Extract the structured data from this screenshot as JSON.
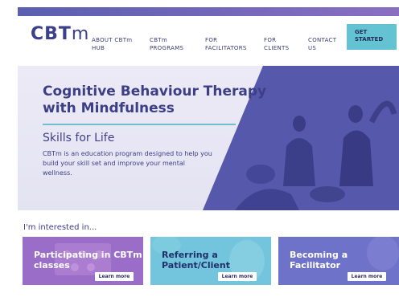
{
  "brand": {
    "logo": "CBTm",
    "logo_main": "CBT",
    "logo_m": "m"
  },
  "nav": {
    "items": [
      {
        "line1": "ABOUT CBTm",
        "line2": "HUB"
      },
      {
        "line1": "CBTm",
        "line2": "PROGRAMS"
      },
      {
        "line1": "FOR",
        "line2": "FACILITATORS"
      },
      {
        "line1": "FOR",
        "line2": "CLIENTS"
      },
      {
        "line1": "CONTACT",
        "line2": "US"
      }
    ],
    "cta": {
      "line1": "GET",
      "line2": "STARTED"
    }
  },
  "hero": {
    "title": "Cognitive Behaviour Therapy with Mindfulness",
    "subtitle": "Skills for Life",
    "text": "CBTm is an education program designed to help you build your skill set and improve your mental wellness."
  },
  "interest": {
    "label": "I'm interested in..."
  },
  "cards": [
    {
      "line1": "Participating in CBTm",
      "line2": "classes",
      "button": "Learn more"
    },
    {
      "line1": "Referring a",
      "line2": "Patient/Client",
      "button": "Learn more"
    },
    {
      "line1": "Becoming a",
      "line2": "Facilitator",
      "button": "Learn more"
    }
  ],
  "colors": {
    "navy": "#3c3f86",
    "teal": "#63c3d2",
    "purple_card": "#9a6ec8",
    "teal_card": "#72c5dc",
    "indigo_card": "#6f72c9"
  }
}
